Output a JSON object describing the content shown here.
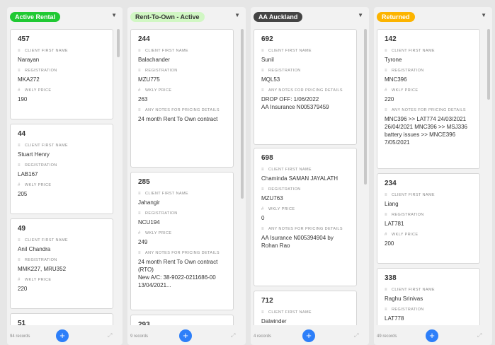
{
  "columns": [
    {
      "title": "Active Rental",
      "badge_bg": "#20c933",
      "badge_fg": "#ffffff",
      "records": "94 records",
      "cards": [
        {
          "title": "457",
          "fields": [
            {
              "label": "CLIENT FIRST NAME",
              "icon": "text-icon",
              "value": "Narayan"
            },
            {
              "label": "REGISTRATION",
              "icon": "text-icon",
              "value": "MKA272"
            },
            {
              "label": "WKLY PRICE",
              "icon": "number-icon",
              "value": "190"
            }
          ]
        },
        {
          "title": "44",
          "fields": [
            {
              "label": "CLIENT FIRST NAME",
              "icon": "text-icon",
              "value": "Stuart Henry"
            },
            {
              "label": "REGISTRATION",
              "icon": "text-icon",
              "value": "LAB167"
            },
            {
              "label": "WKLY PRICE",
              "icon": "number-icon",
              "value": "205"
            }
          ]
        },
        {
          "title": "49",
          "fields": [
            {
              "label": "CLIENT FIRST NAME",
              "icon": "text-icon",
              "value": "Anil Chandra"
            },
            {
              "label": "REGISTRATION",
              "icon": "text-icon",
              "value": "MMK227, MRU352"
            },
            {
              "label": "WKLY PRICE",
              "icon": "number-icon",
              "value": "220"
            }
          ]
        },
        {
          "title": "51",
          "fields": []
        }
      ]
    },
    {
      "title": "Rent-To-Own - Active",
      "badge_bg": "#d1f7c4",
      "badge_fg": "#333333",
      "records": "9 records",
      "cards": [
        {
          "title": "244",
          "fields": [
            {
              "label": "CLIENT FIRST NAME",
              "icon": "text-icon",
              "value": "Balachander"
            },
            {
              "label": "REGISTRATION",
              "icon": "text-icon",
              "value": "MZU775"
            },
            {
              "label": "WKLY PRICE",
              "icon": "number-icon",
              "value": "263"
            },
            {
              "label": "ANY NOTES FOR PRICING DETAILS",
              "icon": "long-text-icon",
              "value": "24 month Rent To Own contract"
            }
          ]
        },
        {
          "title": "285",
          "fields": [
            {
              "label": "CLIENT FIRST NAME",
              "icon": "text-icon",
              "value": "Jahangir"
            },
            {
              "label": "REGISTRATION",
              "icon": "text-icon",
              "value": "NCU194"
            },
            {
              "label": "WKLY PRICE",
              "icon": "number-icon",
              "value": "249"
            },
            {
              "label": "ANY NOTES FOR PRICING DETAILS",
              "icon": "long-text-icon",
              "value": "24 month Rent To Own contract (RTO)\nNew A/C: 38-9022-0211686-00 13/04/2021..."
            }
          ]
        },
        {
          "title": "293",
          "fields": []
        }
      ]
    },
    {
      "title": "AA Auckland",
      "badge_bg": "#444444",
      "badge_fg": "#ffffff",
      "records": "4 records",
      "cards": [
        {
          "title": "692",
          "fields": [
            {
              "label": "CLIENT FIRST NAME",
              "icon": "text-icon",
              "value": "Sunil"
            },
            {
              "label": "REGISTRATION",
              "icon": "text-icon",
              "value": "MQL53"
            },
            {
              "label": "ANY NOTES FOR PRICING DETAILS",
              "icon": "long-text-icon",
              "value": "DROP OFF: 1/06/2022\nAA Insurance N005379459"
            }
          ]
        },
        {
          "title": "698",
          "fields": [
            {
              "label": "CLIENT FIRST NAME",
              "icon": "text-icon",
              "value": "Chaminda SAMAN JAYALATH"
            },
            {
              "label": "REGISTRATION",
              "icon": "text-icon",
              "value": "MZU763"
            },
            {
              "label": "WKLY PRICE",
              "icon": "number-icon",
              "value": "0"
            },
            {
              "label": "ANY NOTES FOR PRICING DETAILS",
              "icon": "long-text-icon",
              "value": "AA Isurance N005394904 by Rohan Rao"
            }
          ]
        },
        {
          "title": "712",
          "fields": [
            {
              "label": "CLIENT FIRST NAME",
              "icon": "text-icon",
              "value": "Dalwinder"
            }
          ]
        }
      ]
    },
    {
      "title": "Returned",
      "badge_bg": "#fcb400",
      "badge_fg": "#ffffff",
      "records": "49 records",
      "cards": [
        {
          "title": "142",
          "fields": [
            {
              "label": "CLIENT FIRST NAME",
              "icon": "text-icon",
              "value": "Tyrone"
            },
            {
              "label": "REGISTRATION",
              "icon": "text-icon",
              "value": "MNC396"
            },
            {
              "label": "WKLY PRICE",
              "icon": "number-icon",
              "value": "220"
            },
            {
              "label": "ANY NOTES FOR PRICING DETAILS",
              "icon": "long-text-icon",
              "value": "MNC396 >> LAT774 24/03/2021 26/04/2021 MNC396 >> MSJ336 battery issues >> MNCE396 7/05/2021"
            }
          ]
        },
        {
          "title": "234",
          "fields": [
            {
              "label": "CLIENT FIRST NAME",
              "icon": "text-icon",
              "value": "Liang"
            },
            {
              "label": "REGISTRATION",
              "icon": "text-icon",
              "value": "LAT781"
            },
            {
              "label": "WKLY PRICE",
              "icon": "number-icon",
              "value": "200"
            }
          ]
        },
        {
          "title": "338",
          "fields": [
            {
              "label": "CLIENT FIRST NAME",
              "icon": "text-icon",
              "value": "Raghu Srinivas"
            },
            {
              "label": "REGISTRATION",
              "icon": "text-icon",
              "value": "LAT778"
            }
          ]
        }
      ]
    }
  ]
}
